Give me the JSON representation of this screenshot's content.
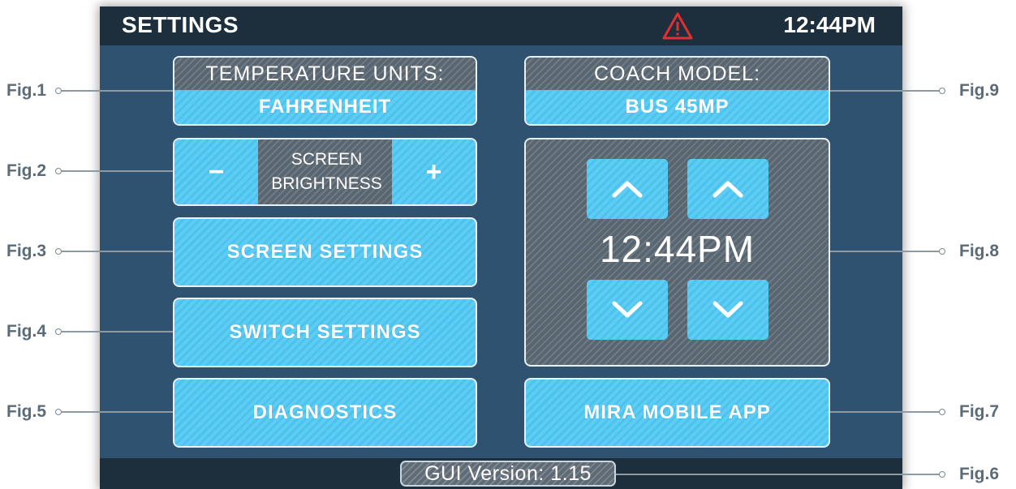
{
  "header": {
    "title": "SETTINGS",
    "time": "12:44PM",
    "alert_icon": "warning-triangle-icon",
    "alert_color": "#e03030"
  },
  "left_panel": {
    "temperature": {
      "label": "TEMPERATURE UNITS:",
      "value": "FAHRENHEIT"
    },
    "brightness": {
      "minus": "−",
      "label_line1": "SCREEN",
      "label_line2": "BRIGHTNESS",
      "plus": "+"
    },
    "screen_settings": "SCREEN SETTINGS",
    "switch_settings": "SWITCH SETTINGS",
    "diagnostics": "DIAGNOSTICS"
  },
  "right_panel": {
    "coach_model": {
      "label": "COACH MODEL:",
      "value": "BUS 45MP"
    },
    "time_setter": {
      "time": "12:44PM",
      "hour_up_icon": "chevron-up-icon",
      "minute_up_icon": "chevron-up-icon",
      "hour_down_icon": "chevron-down-icon",
      "minute_down_icon": "chevron-down-icon"
    },
    "mobile_app": "MIRA MOBILE APP"
  },
  "footer": {
    "version": "GUI Version: 1.15"
  },
  "callouts": {
    "fig1": "Fig.1",
    "fig2": "Fig.2",
    "fig3": "Fig.3",
    "fig4": "Fig.4",
    "fig5": "Fig.5",
    "fig6": "Fig.6",
    "fig7": "Fig.7",
    "fig8": "Fig.8",
    "fig9": "Fig.9"
  },
  "colors": {
    "panel": "#2e5270",
    "bar": "#1d2e3d",
    "accent_blue": "#4cc3ee",
    "hatch_grey": "#6e7b86"
  }
}
